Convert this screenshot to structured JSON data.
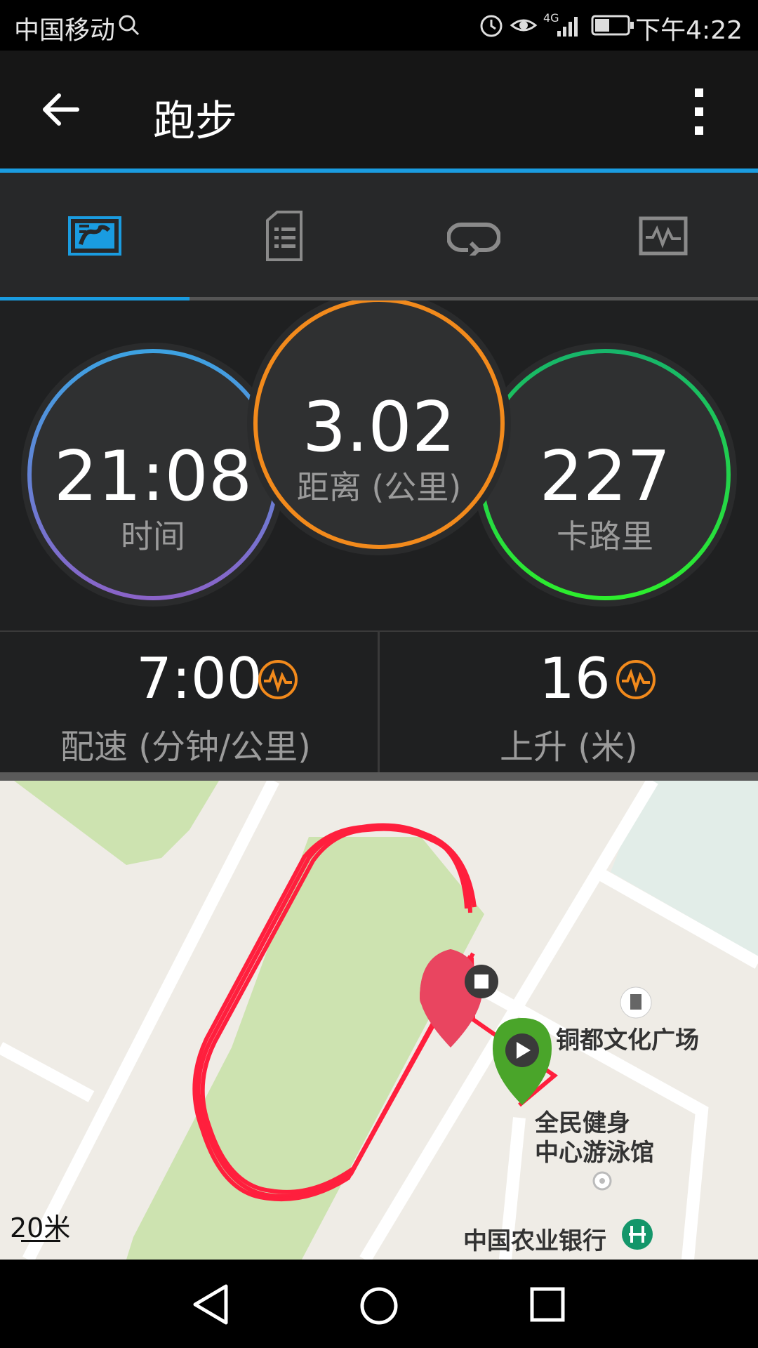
{
  "status_bar": {
    "carrier": "中国移动",
    "time": "下午4:22",
    "network": "4G"
  },
  "app_bar": {
    "title": "跑步"
  },
  "tabs": [
    {
      "icon": "stats-icon",
      "active": true
    },
    {
      "icon": "details-icon",
      "active": false
    },
    {
      "icon": "laps-icon",
      "active": false
    },
    {
      "icon": "graph-icon",
      "active": false
    }
  ],
  "stats": {
    "time": {
      "value": "21:08",
      "label": "时间"
    },
    "distance": {
      "value": "3.02",
      "label": "距离 (公里)"
    },
    "calories": {
      "value": "227",
      "label": "卡路里"
    },
    "pace": {
      "value": "7:00",
      "label": "配速 (分钟/公里)"
    },
    "ascent": {
      "value": "16",
      "label": "上升 (米)"
    }
  },
  "map": {
    "scale": "20米",
    "pois": {
      "square": "铜都文化广场",
      "gym_line1": "全民健身",
      "gym_line2": "中心游泳馆",
      "bank": "中国农业银行"
    }
  },
  "colors": {
    "accent": "#1a9ce0",
    "time_ring": "#4a9be0",
    "distance_ring": "#f28a1c",
    "calories_ring": "#1ed760",
    "track": "#ff1f3d",
    "start_pin": "#4aa52a",
    "end_pin": "#e94560"
  }
}
